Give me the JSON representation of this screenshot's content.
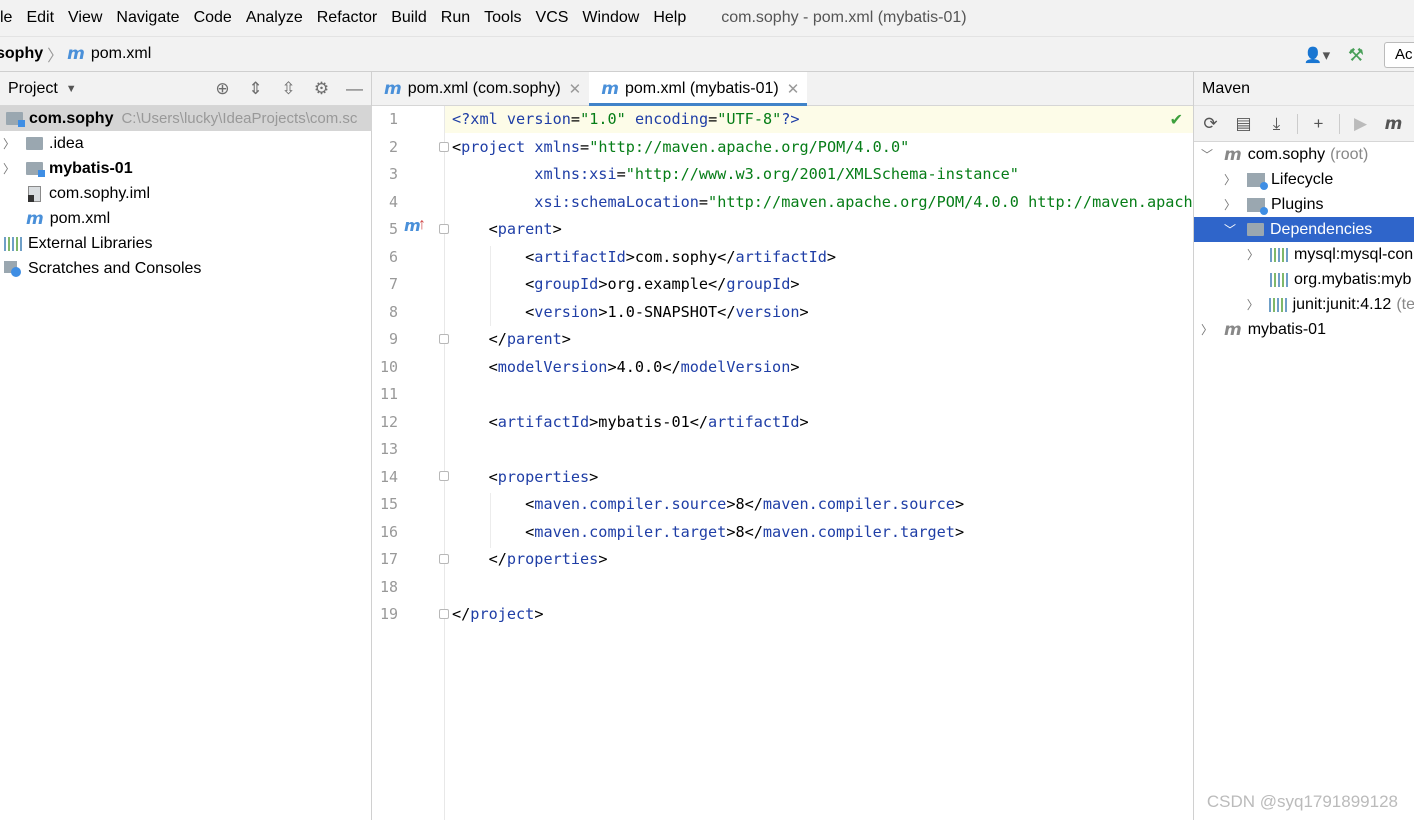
{
  "menubar": {
    "items": [
      "le",
      "Edit",
      "View",
      "Navigate",
      "Code",
      "Analyze",
      "Refactor",
      "Build",
      "Run",
      "Tools",
      "VCS",
      "Window",
      "Help"
    ],
    "window_title": "com.sophy - pom.xml (mybatis-01)"
  },
  "navbar": {
    "root": "sophy",
    "file": "pom.xml",
    "run_config": "Ac"
  },
  "project_panel": {
    "title": "Project",
    "tree": [
      {
        "label": "com.sophy",
        "path": "C:\\Users\\lucky\\IdeaProjects\\com.sc"
      },
      {
        "label": ".idea"
      },
      {
        "label": "mybatis-01"
      },
      {
        "label": "com.sophy.iml"
      },
      {
        "label": "pom.xml"
      },
      {
        "label": "External Libraries"
      },
      {
        "label": "Scratches and Consoles"
      }
    ]
  },
  "editor": {
    "tabs": [
      {
        "label": "pom.xml (com.sophy)"
      },
      {
        "label": "pom.xml (mybatis-01)"
      }
    ],
    "line_numbers": [
      "1",
      "2",
      "3",
      "4",
      "5",
      "6",
      "7",
      "8",
      "9",
      "10",
      "11",
      "12",
      "13",
      "14",
      "15",
      "16",
      "17",
      "18",
      "19"
    ]
  },
  "maven": {
    "title": "Maven",
    "tree": [
      {
        "label": "com.sophy",
        "suffix": "(root)"
      },
      {
        "label": "Lifecycle"
      },
      {
        "label": "Plugins"
      },
      {
        "label": "Dependencies"
      },
      {
        "label": "mysql:mysql-con"
      },
      {
        "label": "org.mybatis:myb"
      },
      {
        "label": "junit:junit:4.12",
        "suffix": "(te"
      },
      {
        "label": "mybatis-01"
      }
    ]
  },
  "watermark": "CSDN @syq1791899128",
  "colors": {
    "accent": "#2f65ca",
    "tag": "#1f3ea6",
    "string": "#067d17",
    "check": "#3da03d"
  }
}
